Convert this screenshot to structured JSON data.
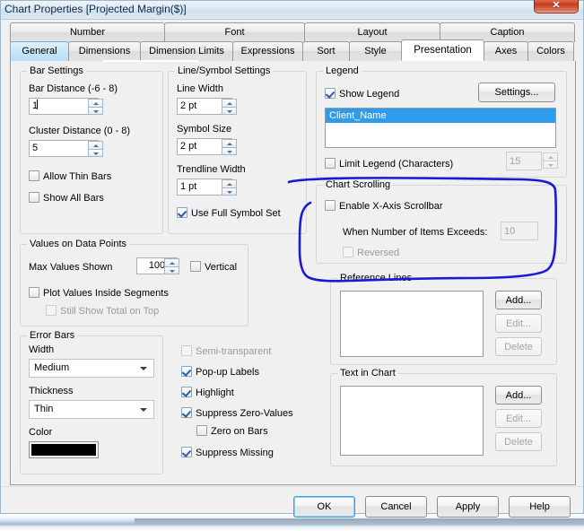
{
  "window": {
    "title": "Chart Properties [Projected Margin($)]",
    "close_label": "✕"
  },
  "tabs": {
    "row1": [
      {
        "label": "Number",
        "state": "normal"
      },
      {
        "label": "Font",
        "state": "normal"
      },
      {
        "label": "Layout",
        "state": "normal"
      },
      {
        "label": "Caption",
        "state": "normal"
      }
    ],
    "row2": [
      {
        "label": "General",
        "state": "hover"
      },
      {
        "label": "Dimensions",
        "state": "normal"
      },
      {
        "label": "Dimension Limits",
        "state": "normal"
      },
      {
        "label": "Expressions",
        "state": "normal"
      },
      {
        "label": "Sort",
        "state": "normal"
      },
      {
        "label": "Style",
        "state": "normal"
      },
      {
        "label": "Presentation",
        "state": "active"
      },
      {
        "label": "Axes",
        "state": "normal"
      },
      {
        "label": "Colors",
        "state": "normal"
      }
    ]
  },
  "bar_settings": {
    "title": "Bar Settings",
    "bar_distance_label": "Bar Distance (-6 - 8)",
    "bar_distance_value": "1",
    "cluster_distance_label": "Cluster Distance (0 - 8)",
    "cluster_distance_value": "5",
    "allow_thin_bars": "Allow Thin Bars",
    "show_all_bars": "Show All Bars"
  },
  "line_symbol": {
    "title": "Line/Symbol Settings",
    "line_width_label": "Line Width",
    "line_width_value": "2 pt",
    "symbol_size_label": "Symbol Size",
    "symbol_size_value": "2 pt",
    "trendline_width_label": "Trendline Width",
    "trendline_width_value": "1 pt",
    "use_full_symbol_set": "Use Full Symbol Set"
  },
  "values_on_data_points": {
    "title": "Values on Data Points",
    "max_values_label": "Max Values Shown",
    "max_values_value": "100",
    "vertical": "Vertical",
    "plot_values_inside_segments": "Plot Values Inside Segments",
    "still_show_total_on_top": "Still Show Total on Top"
  },
  "error_bars": {
    "title": "Error Bars",
    "width_label": "Width",
    "width_value": "Medium",
    "thickness_label": "Thickness",
    "thickness_value": "Thin",
    "color_label": "Color",
    "color_value": "#000000"
  },
  "misc_options": [
    {
      "label": "Semi-transparent",
      "checked": false,
      "disabled": true
    },
    {
      "label": "Pop-up Labels",
      "checked": true,
      "disabled": false
    },
    {
      "label": "Highlight",
      "checked": true,
      "disabled": false
    },
    {
      "label": "Suppress Zero-Values",
      "checked": true,
      "disabled": false
    },
    {
      "label": "Zero on Bars",
      "checked": false,
      "disabled": false
    },
    {
      "label": "Suppress Missing",
      "checked": true,
      "disabled": false
    }
  ],
  "legend": {
    "title": "Legend",
    "show_legend": "Show Legend",
    "settings_button": "Settings...",
    "items": [
      {
        "label": "Client_Name",
        "selected": true
      }
    ],
    "limit_legend": "Limit Legend (Characters)",
    "limit_value": "15"
  },
  "chart_scrolling": {
    "title": "Chart Scrolling",
    "enable_scrollbar": "Enable X-Axis Scrollbar",
    "when_exceeds_label": "When Number of Items Exceeds:",
    "when_exceeds_value": "10",
    "reversed": "Reversed"
  },
  "reference_lines": {
    "title": "Reference Lines",
    "items": [],
    "add_button": "Add...",
    "edit_button": "Edit...",
    "delete_button": "Delete"
  },
  "text_in_chart": {
    "title": "Text in Chart",
    "items": [],
    "add_button": "Add...",
    "edit_button": "Edit...",
    "delete_button": "Delete"
  },
  "footer": {
    "ok": "OK",
    "cancel": "Cancel",
    "apply": "Apply",
    "help": "Help"
  },
  "annotation": {
    "color": "#1a1ad4",
    "shape": "hand-drawn-circle-around-chart-scrolling"
  }
}
